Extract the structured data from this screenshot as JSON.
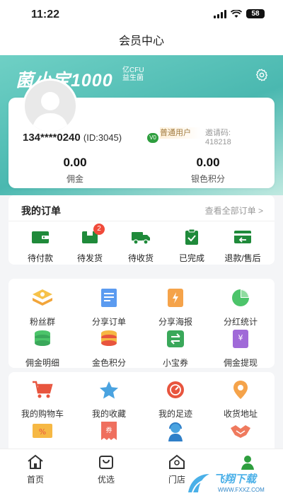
{
  "status": {
    "time": "11:22",
    "battery": "58"
  },
  "header": {
    "title": "会员中心"
  },
  "banner": {
    "brand": "菌小宝1000",
    "brand_cfu_line1": "亿CFU",
    "brand_cfu_line2": "益生菌",
    "settings_icon": "gear-icon"
  },
  "profile": {
    "phone": "134****0240",
    "id_text": "(ID:3045)",
    "level_badge": "V0",
    "level_name": "普通用户",
    "invite_label": "邀请码:",
    "invite_code": "418218",
    "stats": [
      {
        "value": "0.00",
        "label": "佣金"
      },
      {
        "value": "0.00",
        "label": "银色积分"
      }
    ]
  },
  "orders": {
    "title": "我的订单",
    "see_all": "查看全部订单 >",
    "items": [
      {
        "label": "待付款",
        "icon": "wallet-icon"
      },
      {
        "label": "待发货",
        "icon": "box-icon",
        "badge": "2"
      },
      {
        "label": "待收货",
        "icon": "truck-icon"
      },
      {
        "label": "已完成",
        "icon": "clipboard-check-icon"
      },
      {
        "label": "退款/售后",
        "icon": "refund-icon"
      }
    ]
  },
  "tools": {
    "items": [
      {
        "label": "粉丝群",
        "icon": "fans-group-icon"
      },
      {
        "label": "分享订单",
        "icon": "share-order-icon"
      },
      {
        "label": "分享海报",
        "icon": "share-poster-icon"
      },
      {
        "label": "分红统计",
        "icon": "pie-chart-icon"
      },
      {
        "label": "佣金明细",
        "icon": "coin-stack-icon"
      },
      {
        "label": "金色积分",
        "icon": "gold-points-icon"
      },
      {
        "label": "小宝券",
        "icon": "exchange-icon"
      },
      {
        "label": "佣金提现",
        "icon": "withdraw-icon"
      }
    ]
  },
  "services": {
    "items": [
      {
        "label": "我的购物车",
        "icon": "cart-icon"
      },
      {
        "label": "我的收藏",
        "icon": "star-icon"
      },
      {
        "label": "我的足迹",
        "icon": "footprint-icon"
      },
      {
        "label": "收货地址",
        "icon": "location-icon"
      },
      {
        "label": "",
        "icon": "coupon-icon"
      },
      {
        "label": "",
        "icon": "voucher-icon"
      },
      {
        "label": "",
        "icon": "customer-service-icon"
      },
      {
        "label": "",
        "icon": "handshake-icon"
      }
    ]
  },
  "tabbar": {
    "items": [
      {
        "label": "首页",
        "icon": "home-icon"
      },
      {
        "label": "优选",
        "icon": "bag-icon"
      },
      {
        "label": "门店",
        "icon": "store-icon"
      },
      {
        "label": "",
        "icon": "user-icon",
        "active": true
      }
    ]
  },
  "watermark": {
    "text": "飞翔下载",
    "url": "WWW.FXXZ.COM"
  },
  "colors": {
    "accent": "#2e9e3e",
    "banner": "#4ab8b0",
    "badge": "#f04a3a"
  }
}
